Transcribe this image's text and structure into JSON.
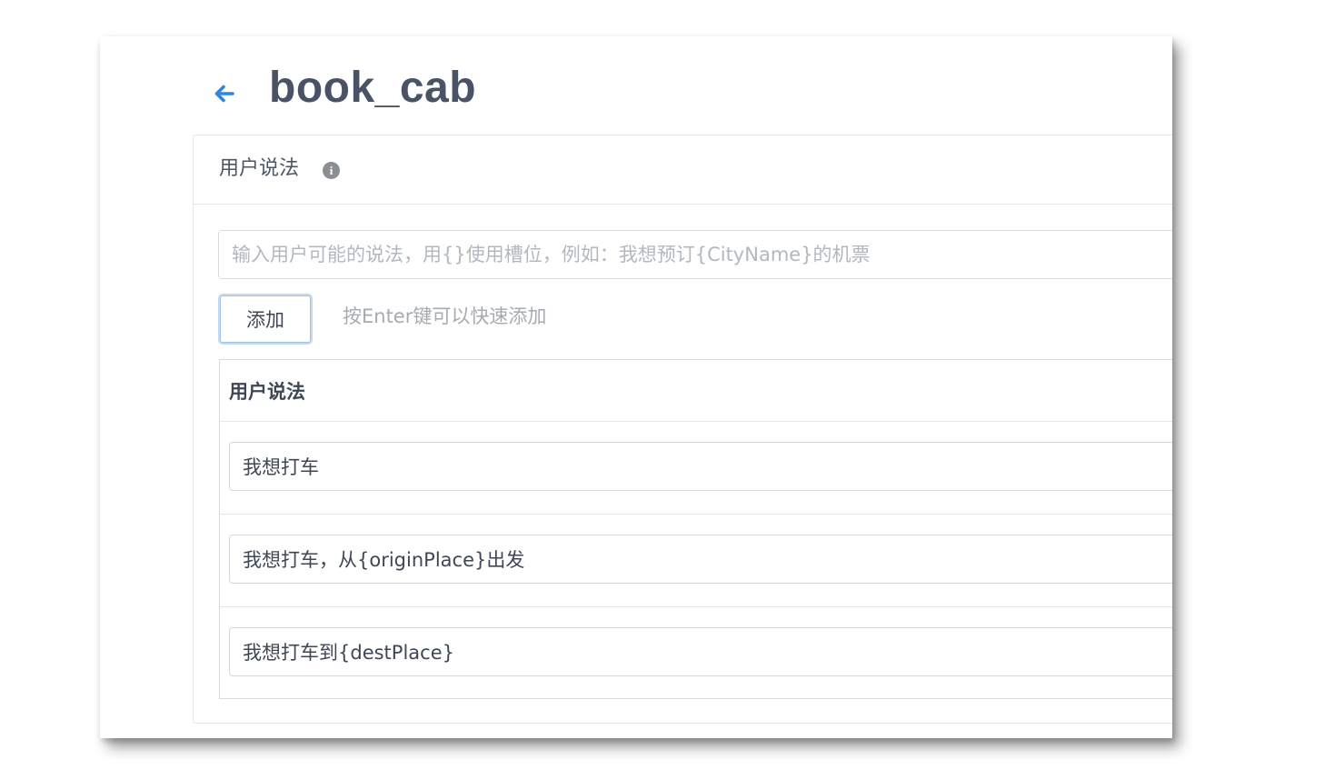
{
  "colors": {
    "accent": "#2f86e0",
    "title": "#4a5366",
    "placeholder": "#b3b8bf",
    "border": "#d9dde2"
  },
  "header": {
    "back_icon": "arrow-left-icon",
    "title": "book_cab"
  },
  "utterance_panel": {
    "title": "用户说法",
    "info_icon": "info-icon",
    "info_glyph": "i",
    "input_placeholder": "输入用户可能的说法，用{}使用槽位，例如：我想预订{CityName}的机票",
    "input_value": "",
    "add_button_label": "添加",
    "hint": "按Enter键可以快速添加"
  },
  "utterance_table": {
    "column_header": "用户说法",
    "rows": [
      {
        "value": "我想打车"
      },
      {
        "value": "我想打车，从{originPlace}出发"
      },
      {
        "value": "我想打车到{destPlace}"
      }
    ]
  }
}
